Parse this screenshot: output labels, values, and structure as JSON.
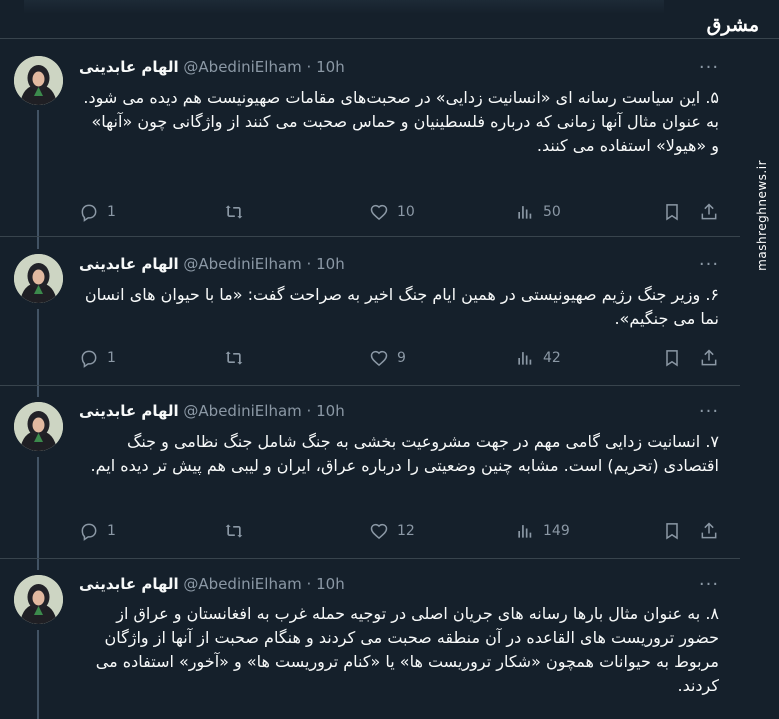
{
  "watermark": {
    "logo": "مشرق",
    "site": "mashreghnews.ir"
  },
  "colors": {
    "background": "#15202b",
    "text": "#f7f9f9",
    "muted": "#8b98a5",
    "divider": "#38444d"
  },
  "tweets": [
    {
      "name": "الهام عابدینی",
      "handle": "@AbediniElham",
      "dot": "·",
      "time": "10h",
      "more": "···",
      "text": "۵. این سیاست رسانه ای «انسانیت زدایی» در صحبت‌های مقامات صهیونیست هم دیده می شود.\nبه عنوان مثال آنها زمانی که درباره فلسطینیان و حماس صحبت می کنند از واژگانی چون «آنها» و «هیولا» استفاده می کنند.",
      "replies": "1",
      "reposts": "",
      "likes": "10",
      "views": "50"
    },
    {
      "name": "الهام عابدینی",
      "handle": "@AbediniElham",
      "dot": "·",
      "time": "10h",
      "more": "···",
      "text": "۶. وزیر جنگ رژیم صهیونیستی در همین ایام جنگ اخیر به صراحت گفت: «ما با حیوان های انسان نما می جنگیم».",
      "replies": "1",
      "reposts": "",
      "likes": "9",
      "views": "42"
    },
    {
      "name": "الهام عابدینی",
      "handle": "@AbediniElham",
      "dot": "·",
      "time": "10h",
      "more": "···",
      "text": "۷. انسانیت زدایی گامی مهم در جهت مشروعیت بخشی به جنگ شامل جنگ نظامی و جنگ اقتصادی (تحریم) است. مشابه چنین وضعیتی را درباره عراق، ایران و لیبی هم پیش تر دیده ایم.",
      "replies": "1",
      "reposts": "",
      "likes": "12",
      "views": "149"
    },
    {
      "name": "الهام عابدینی",
      "handle": "@AbediniElham",
      "dot": "·",
      "time": "10h",
      "more": "···",
      "text": "۸. به عنوان مثال بارها رسانه های جریان اصلی در توجیه حمله غرب به افغانستان و عراق از حضور تروریست های القاعده در آن منطقه صحبت می کردند و هنگام صحبت از آنها از واژگان مربوط به حیوانات همچون «شکار تروریست ها» یا «کنام تروریست ها» و «آخور» استفاده می کردند.",
      "replies": "",
      "reposts": "",
      "likes": "",
      "views": ""
    }
  ]
}
